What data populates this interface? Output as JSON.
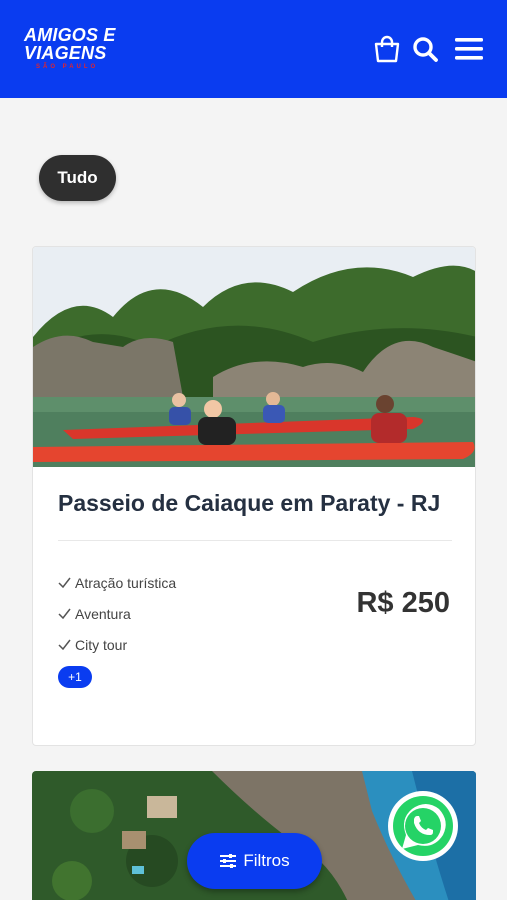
{
  "header": {
    "logo_line1": "AMIGOS E",
    "logo_line2": "VIAGENS",
    "logo_sub": "SÃO PAULO"
  },
  "filters": {
    "chip_label": "Tudo"
  },
  "cards": [
    {
      "title": "Passeio de Caiaque em Paraty - RJ",
      "tags": [
        "Atração turística",
        "Aventura",
        "City tour"
      ],
      "more_tags": "+1",
      "price": "R$ 250"
    }
  ],
  "filter_button": {
    "label": "Filtros"
  },
  "colors": {
    "brand": "#0a3cf0",
    "chip": "#2f2f2f",
    "whatsapp": "#25d366"
  },
  "icons": [
    "shopping-bag-icon",
    "search-icon",
    "menu-icon",
    "check-icon",
    "sliders-icon",
    "whatsapp-icon"
  ]
}
